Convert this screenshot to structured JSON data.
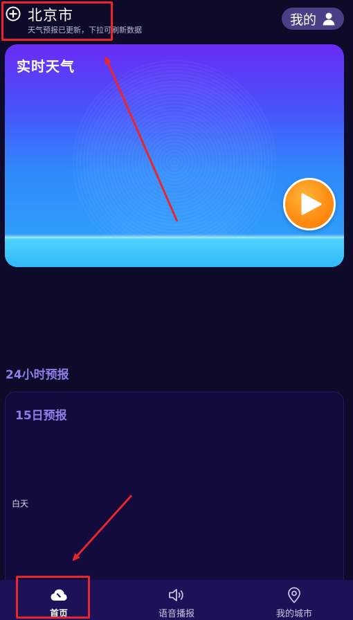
{
  "header": {
    "city": "北京市",
    "update_tip": "天气预报已更新，下拉可刷新数据",
    "mine_label": "我的"
  },
  "realtime": {
    "title": "实时天气"
  },
  "hourly": {
    "title": "24小时预报"
  },
  "daily": {
    "title": "15日预报",
    "daytime_label": "白天"
  },
  "tabbar": {
    "items": [
      {
        "label": "首页",
        "icon": "cloud-icon",
        "active": true
      },
      {
        "label": "语音播报",
        "icon": "speaker-icon",
        "active": false
      },
      {
        "label": "我的城市",
        "icon": "location-pin-icon",
        "active": false
      }
    ]
  },
  "colors": {
    "background": "#0e0a2a",
    "card_gradient_top": "#6a2cf6",
    "card_gradient_bottom": "#2f9cfb",
    "accent_purple": "#8f7ee8",
    "play_orange": "#ff8a10",
    "tabbar": "#1d1157",
    "annotation_red": "#e8262b"
  }
}
